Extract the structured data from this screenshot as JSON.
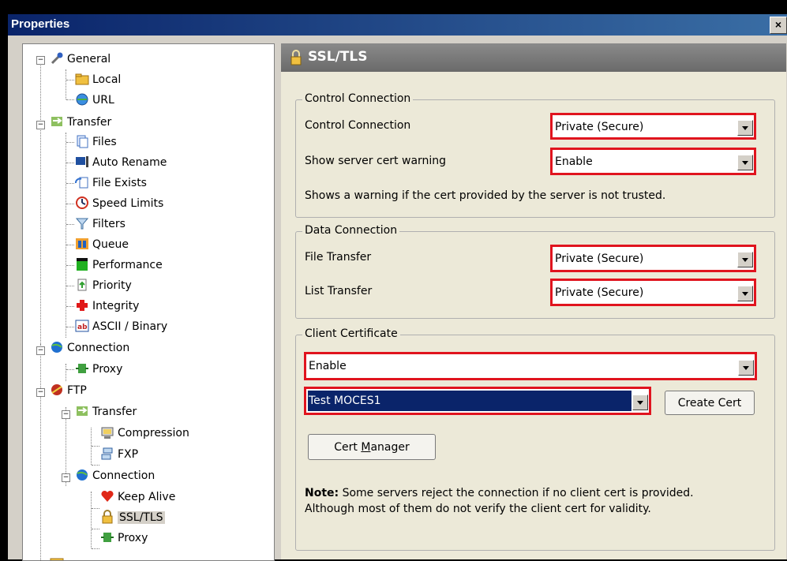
{
  "window": {
    "title": "Properties",
    "close_label": "×"
  },
  "tree": [
    {
      "label": "General"
    },
    {
      "label": "Local"
    },
    {
      "label": "URL"
    },
    {
      "label": "Transfer"
    },
    {
      "label": "Files"
    },
    {
      "label": "Auto Rename"
    },
    {
      "label": "File Exists"
    },
    {
      "label": "Speed Limits"
    },
    {
      "label": "Filters"
    },
    {
      "label": "Queue"
    },
    {
      "label": "Performance"
    },
    {
      "label": "Priority"
    },
    {
      "label": "Integrity"
    },
    {
      "label": "ASCII / Binary"
    },
    {
      "label": "Connection"
    },
    {
      "label": "Proxy"
    },
    {
      "label": "FTP"
    },
    {
      "label": "Transfer"
    },
    {
      "label": "Compression"
    },
    {
      "label": "FXP"
    },
    {
      "label": "Connection"
    },
    {
      "label": "Keep Alive"
    },
    {
      "label": "SSL/TLS"
    },
    {
      "label": "Proxy"
    }
  ],
  "panel": {
    "title": "SSL/TLS"
  },
  "control": {
    "group_label": "Control Connection",
    "conn_label": "Control Connection",
    "conn_value": "Private (Secure)",
    "warn_label": "Show server cert warning",
    "warn_value": "Enable",
    "hint": "Shows a warning if the cert provided by the server is not trusted."
  },
  "data": {
    "group_label": "Data Connection",
    "file_label": "File Transfer",
    "file_value": "Private (Secure)",
    "list_label": "List Transfer",
    "list_value": "Private (Secure)"
  },
  "client": {
    "group_label": "Client Certificate",
    "enable_value": "Enable",
    "cert_value": "Test MOCES1",
    "create_cert_label": "Create Cert",
    "cert_manager_prefix": "Cert ",
    "cert_manager_underlined": "M",
    "cert_manager_rest": "anager",
    "note_bold": "Note:",
    "note_line1": " Some servers reject the connection if no client cert is provided.",
    "note_line2": "Although most of them do not verify the client cert for validity."
  },
  "colors": {
    "highlight_border": "#e0141e",
    "selection": "#0a246a"
  }
}
